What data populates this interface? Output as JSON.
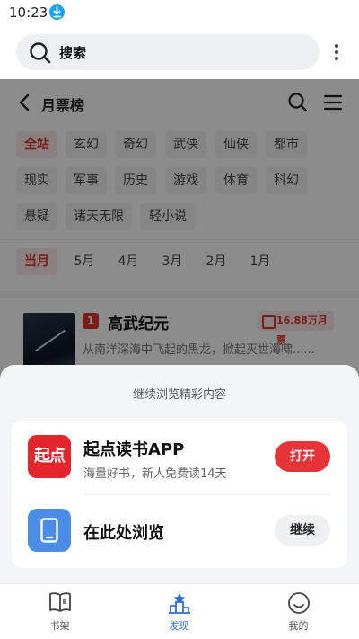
{
  "status_bar": {
    "time": "10:23"
  },
  "browser": {
    "search_label": "搜索"
  },
  "page": {
    "title": "月票榜",
    "categories": [
      "全站",
      "玄幻",
      "奇幻",
      "武侠",
      "仙侠",
      "都市",
      "现实",
      "军事",
      "历史",
      "游戏",
      "体育",
      "科幻",
      "悬疑",
      "诸天无限",
      "轻小说"
    ],
    "active_category": "全站",
    "months": [
      "当月",
      "5月",
      "4月",
      "3月",
      "2月",
      "1月"
    ],
    "active_month": "当月",
    "book": {
      "rank": "1",
      "title": "高武纪元",
      "tickets": "16.88万月票",
      "description": "从南洋深海中飞起的黑龙，掀起灭世海啸......"
    }
  },
  "sheet": {
    "heading": "继续浏览精彩内容",
    "app_icon_text": "起点",
    "app_name": "起点读书APP",
    "app_subtitle": "海量好书，新人免费读14天",
    "open_label": "打开",
    "browse_label": "在此处浏览",
    "continue_label": "继续"
  },
  "tabbar": {
    "tabs": [
      {
        "label": "书架",
        "icon": "book-icon"
      },
      {
        "label": "发现",
        "icon": "discover-icon"
      },
      {
        "label": "我的",
        "icon": "smiley-icon"
      }
    ],
    "active": "发现"
  },
  "colors": {
    "accent_red": "#e53338",
    "accent_blue": "#2f6fe0"
  }
}
